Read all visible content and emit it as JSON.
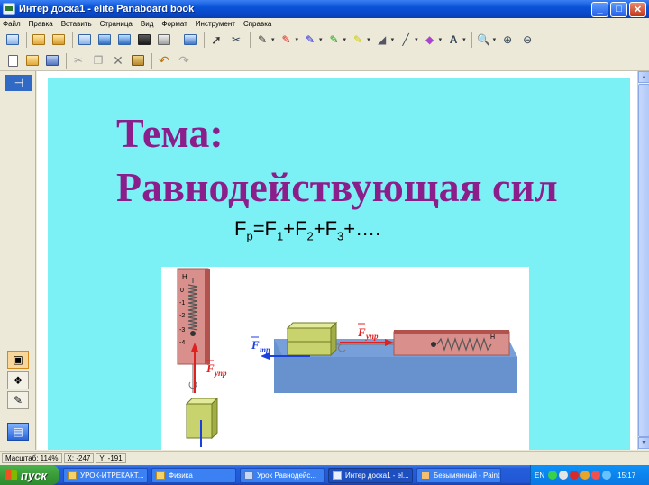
{
  "window": {
    "title": "Интер доска1 - elite Panaboard book"
  },
  "menu": [
    "Файл",
    "Правка",
    "Вставить",
    "Страница",
    "Вид",
    "Формат",
    "Инструмент",
    "Справка"
  ],
  "toolbar1": {
    "icons": [
      "new-page-icon",
      "open-icon",
      "save-icon",
      "camera-icon",
      "capture-icon",
      "capture-window-icon",
      "capture-area-icon",
      "print-icon",
      "mail-icon",
      "select-arrow-icon",
      "scissors-icon",
      "pen-icon",
      "pen-red-icon",
      "pen-blue-icon",
      "pen-green-icon",
      "highlighter-icon",
      "eraser-icon",
      "line-icon",
      "fill-icon",
      "text-icon",
      "zoom-icon",
      "zoom-in-icon",
      "zoom-out-icon"
    ]
  },
  "toolbar2": {
    "icons": [
      "new-doc-icon",
      "open-folder-icon",
      "save-disk-icon",
      "cut-icon",
      "copy-icon",
      "delete-icon",
      "paste-icon",
      "undo-icon",
      "redo-icon"
    ]
  },
  "slide": {
    "title_line1": "Тема:",
    "title_line2": "Равнодействующая сил",
    "formula": {
      "parts": [
        "F",
        "р",
        "=F",
        "1",
        "+F",
        "2",
        "+F",
        "3",
        "+…."
      ]
    },
    "diagram": {
      "left_force_label": "F",
      "left_force_sub": "упр",
      "center_friction_label": "F",
      "center_friction_sub": "тр",
      "right_force_label": "F",
      "right_force_sub": "упр",
      "scale_top_letter": "Н",
      "scale_left_ticks": [
        "0",
        "-1",
        "-2",
        "-3",
        "-4"
      ],
      "scale_right_letter": "Н"
    }
  },
  "statusbar": {
    "zoom": "Масштаб: 114%",
    "x": "X: -247",
    "y": "Y: -191"
  },
  "taskbar": {
    "start_label": "пуск",
    "tasks": [
      {
        "label": "УРОК-ИТРЕКАКТ...",
        "active": false
      },
      {
        "label": "Физика",
        "active": false
      },
      {
        "label": "Урок Равнодейс...",
        "active": false
      },
      {
        "label": "Интер доска1 - el...",
        "active": true
      },
      {
        "label": "Безымянный - Paint",
        "active": false
      }
    ],
    "lang": "EN",
    "clock": "15:17"
  },
  "colors": {
    "slide_bg": "#7cf1f5",
    "title_color": "#8b1e8b",
    "force_red": "#e02020",
    "force_blue": "#1c3fe0",
    "table_blue": "#4d7fc4",
    "spring_panel": "#d9908c"
  }
}
